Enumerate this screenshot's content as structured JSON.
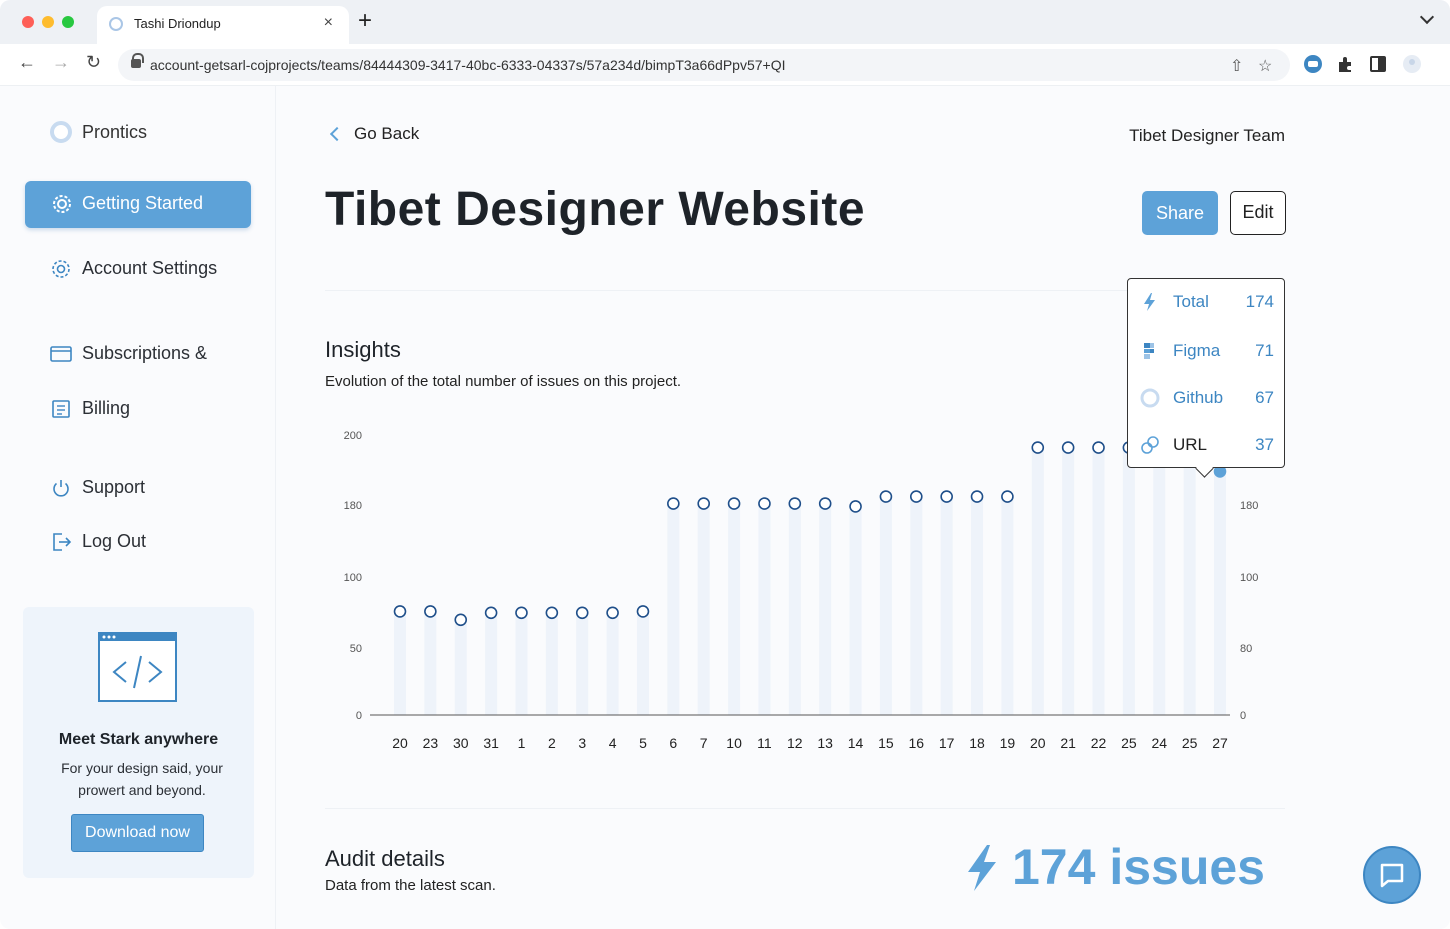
{
  "browser": {
    "tab_title": "Tashi Driondup",
    "tab_close": "×",
    "new_tab": "+",
    "url": "account-getsarl-cojprojects/teams/84444309-3417-40bc-6333-04337s/57a234d/bimpT3a66dPpv57+QI"
  },
  "sidebar": {
    "brand": "Prontics",
    "items": [
      {
        "label": "Getting Started",
        "icon": "gear-badge-icon"
      },
      {
        "label": "Account Settings",
        "icon": "gear-icon"
      },
      {
        "label": "Subscriptions &",
        "icon": "card-icon"
      },
      {
        "label": "Billing",
        "icon": "invoice-icon"
      },
      {
        "label": "Support",
        "icon": "power-icon"
      },
      {
        "label": "Log Out",
        "icon": "logout-icon"
      }
    ],
    "promo": {
      "title": "Meet Stark anywhere",
      "text_line1": "For your design said, your",
      "text_line2": "prowert and beyond.",
      "button": "Download now"
    }
  },
  "header": {
    "go_back": "Go Back",
    "team": "Tibet Designer Team",
    "title": "Tibet Designer Website",
    "share": "Share",
    "edit": "Edit"
  },
  "insights": {
    "title": "Insights",
    "subtitle": "Evolution of the total number of issues on this project."
  },
  "tooltip": {
    "rows": [
      {
        "label": "Total",
        "value": "174",
        "icon": "bolt-icon"
      },
      {
        "label": "Figma",
        "value": "71",
        "icon": "figma-icon"
      },
      {
        "label": "Github",
        "value": "67",
        "icon": "github-icon"
      },
      {
        "label": "URL",
        "value": "37",
        "icon": "link-icon"
      }
    ]
  },
  "audit": {
    "title": "Audit details",
    "subtitle": "Data from the latest scan.",
    "issues": "174 issues"
  },
  "colors": {
    "accent": "#5da2d8",
    "accent_dark": "#3d86c2",
    "bar": "#eef3fa"
  },
  "chart_data": {
    "type": "scatter",
    "categories": [
      "20",
      "23",
      "30",
      "31",
      "1",
      "2",
      "3",
      "4",
      "5",
      "6",
      "7",
      "10",
      "11",
      "12",
      "13",
      "14",
      "15",
      "16",
      "17",
      "18",
      "19",
      "20",
      "21",
      "22",
      "25",
      "24",
      "25",
      "27"
    ],
    "values": [
      74,
      74,
      68,
      73,
      73,
      73,
      73,
      73,
      74,
      151,
      151,
      151,
      151,
      151,
      151,
      149,
      156,
      156,
      156,
      156,
      156,
      191,
      191,
      191,
      191,
      191,
      191,
      174
    ],
    "highlight_index": 27,
    "y_ticks_left": [
      "200",
      "180",
      "100",
      "50",
      "0"
    ],
    "y_ticks_right": [
      "180",
      "100",
      "80",
      "0"
    ],
    "ylim": [
      0,
      200
    ]
  }
}
